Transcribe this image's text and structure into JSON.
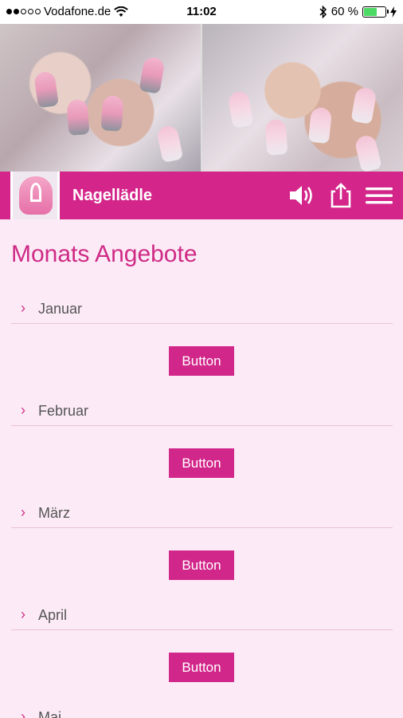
{
  "status_bar": {
    "carrier": "Vodafone.de",
    "time": "11:02",
    "battery_percent": "60 %",
    "battery_level": 0.6,
    "signal_bars_filled": 2,
    "signal_bars_total": 5
  },
  "app_bar": {
    "title": "Nagellädle",
    "background_color": "#d4268a",
    "icons": [
      "sound-icon",
      "share-icon",
      "menu-icon"
    ]
  },
  "page": {
    "title": "Monats Angebote",
    "accent_color": "#cf2a86",
    "background_color": "#fcebf6"
  },
  "months": [
    {
      "label": "Januar",
      "button_label": "Button"
    },
    {
      "label": "Februar",
      "button_label": "Button"
    },
    {
      "label": "März",
      "button_label": "Button"
    },
    {
      "label": "April",
      "button_label": "Button"
    },
    {
      "label": "Mai"
    }
  ]
}
